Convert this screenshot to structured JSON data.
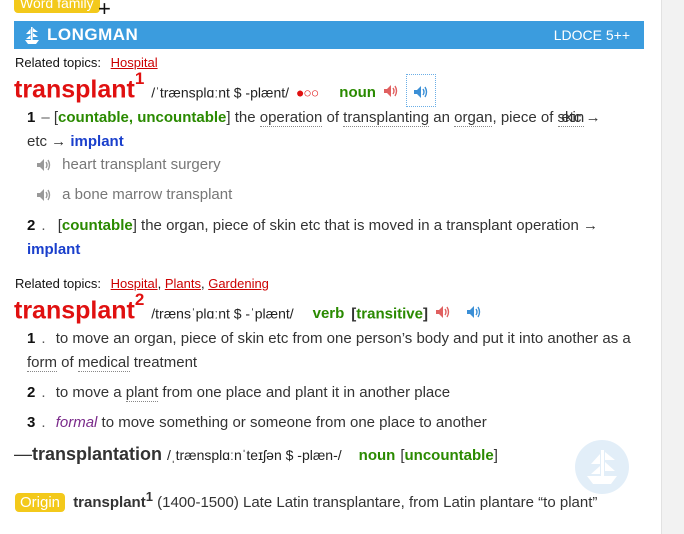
{
  "word_family": {
    "label": "Word family",
    "toggle": "+"
  },
  "header": {
    "brand": "LONGMAN",
    "version": "LDOCE 5++"
  },
  "entry1": {
    "topics_label": "Related topics:",
    "topics": [
      "Hospital"
    ],
    "headword": "transplant",
    "homnum": "1",
    "pron": "/ˈtrænsplɑːnt $ -plænt/",
    "freq": "●○○",
    "pos": "noun",
    "senses": [
      {
        "num": "1",
        "gram": "countable, uncountable",
        "def_a": "the ",
        "def_u1": "operation",
        "def_b": " of ",
        "def_u2": "transplanting",
        "def_c": " an ",
        "def_u3": "organ",
        "def_d": ", piece of ",
        "def_u4": "skin",
        "def_e": " etc → ",
        "xref": "implant",
        "examples": [
          "heart transplant surgery",
          "a bone marrow transplant"
        ]
      },
      {
        "num": "2",
        "gram": "countable",
        "def": "the organ, piece of skin etc that is moved in a transplant operation →",
        "xref": "implant"
      }
    ]
  },
  "entry2": {
    "topics_label": "Related topics:",
    "topics": [
      "Hospital",
      "Plants",
      "Gardening"
    ],
    "headword": "transplant",
    "homnum": "2",
    "pron": "/trænsˈplɑːnt $ -ˈplænt/",
    "pos": "verb",
    "gram": "transitive",
    "senses": [
      {
        "num": "1",
        "def_a": "to move an organ, piece of skin etc from one person’s body and put it into another as a ",
        "def_u1": "form",
        "def_b": " of ",
        "def_u2": "medical",
        "def_c": " treatment"
      },
      {
        "num": "2",
        "def_a": "to move a ",
        "def_u1": "plant",
        "def_b": " from one place and plant it in another place"
      },
      {
        "num": "3",
        "register": "formal",
        "def": "to move something or someone from one place to another"
      }
    ]
  },
  "derivative": {
    "dash": "—",
    "word": "transplantation",
    "pron": "/ˌtrænsplɑːnˈteɪʃən $ -plæn-/",
    "pos": "noun",
    "gram": "uncountable"
  },
  "origin": {
    "label": "Origin",
    "word": "transplant",
    "homnum": "1",
    "text": "(1400-1500) Late Latin transplantare, from Latin plantare “to plant”"
  },
  "colors": {
    "accent": "#3b9cde",
    "headword": "#e01010",
    "pos": "#2a8a00",
    "xref": "#1a3fcc",
    "badge": "#f3c91b"
  }
}
